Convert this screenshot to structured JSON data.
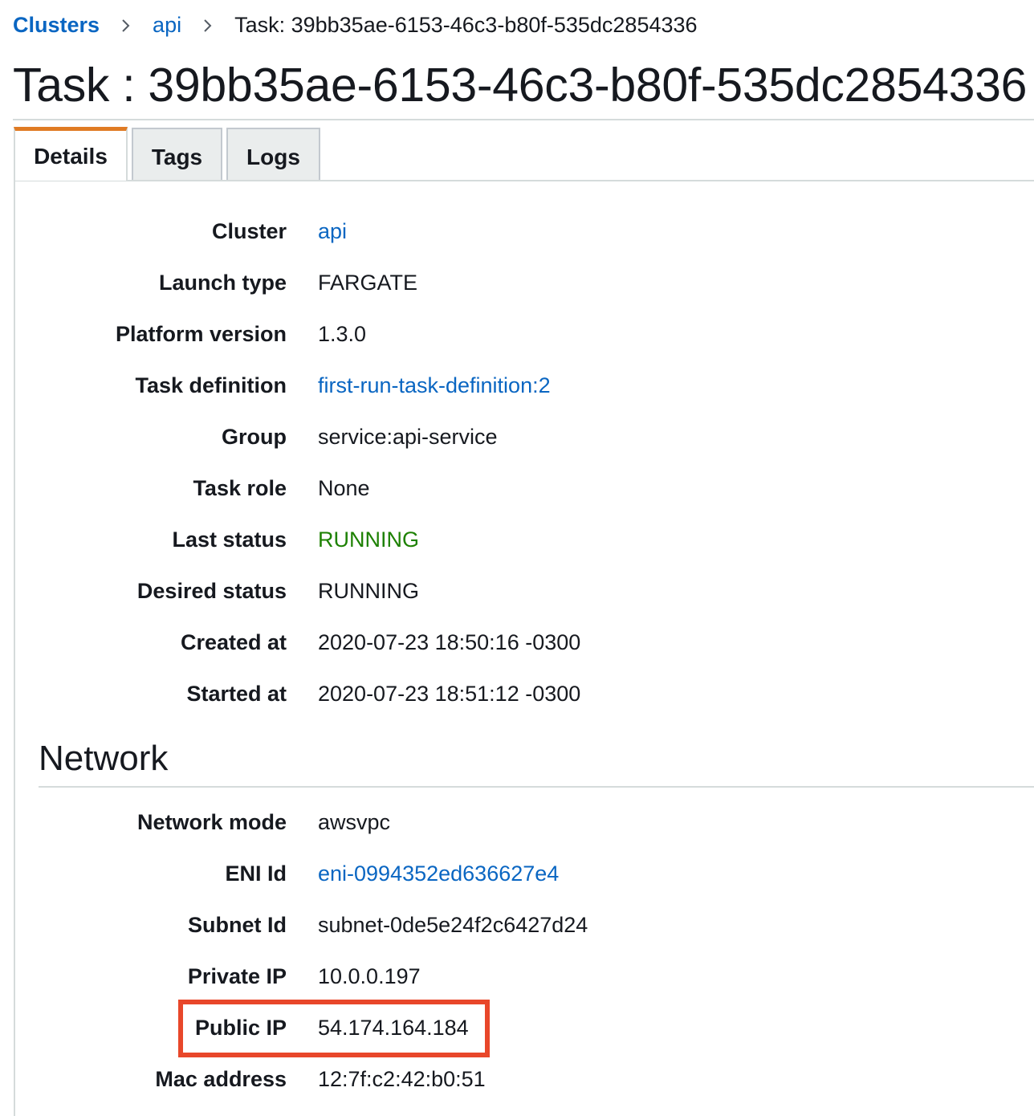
{
  "breadcrumb": {
    "items": [
      "Clusters",
      "api"
    ],
    "current": "Task: 39bb35ae-6153-46c3-b80f-535dc2854336"
  },
  "page_title": "Task : 39bb35ae-6153-46c3-b80f-535dc2854336",
  "tabs": [
    {
      "label": "Details",
      "active": true
    },
    {
      "label": "Tags",
      "active": false
    },
    {
      "label": "Logs",
      "active": false
    }
  ],
  "details": {
    "cluster": {
      "label": "Cluster",
      "value": "api"
    },
    "launch_type": {
      "label": "Launch type",
      "value": "FARGATE"
    },
    "platform_version": {
      "label": "Platform version",
      "value": "1.3.0"
    },
    "task_definition": {
      "label": "Task definition",
      "value": "first-run-task-definition:2"
    },
    "group": {
      "label": "Group",
      "value": "service:api-service"
    },
    "task_role": {
      "label": "Task role",
      "value": "None"
    },
    "last_status": {
      "label": "Last status",
      "value": "RUNNING"
    },
    "desired_status": {
      "label": "Desired status",
      "value": "RUNNING"
    },
    "created_at": {
      "label": "Created at",
      "value": "2020-07-23 18:50:16 -0300"
    },
    "started_at": {
      "label": "Started at",
      "value": "2020-07-23 18:51:12 -0300"
    }
  },
  "network": {
    "heading": "Network",
    "network_mode": {
      "label": "Network mode",
      "value": "awsvpc"
    },
    "eni_id": {
      "label": "ENI Id",
      "value": "eni-0994352ed636627e4"
    },
    "subnet_id": {
      "label": "Subnet Id",
      "value": "subnet-0de5e24f2c6427d24"
    },
    "private_ip": {
      "label": "Private IP",
      "value": "10.0.0.197"
    },
    "public_ip": {
      "label": "Public IP",
      "value": "54.174.164.184"
    },
    "mac_address": {
      "label": "Mac address",
      "value": "12:7f:c2:42:b0:51"
    }
  },
  "colors": {
    "link": "#0a66c2",
    "status_running": "#1d8102",
    "tab_accent": "#e07b24",
    "highlight": "#e8472a"
  }
}
